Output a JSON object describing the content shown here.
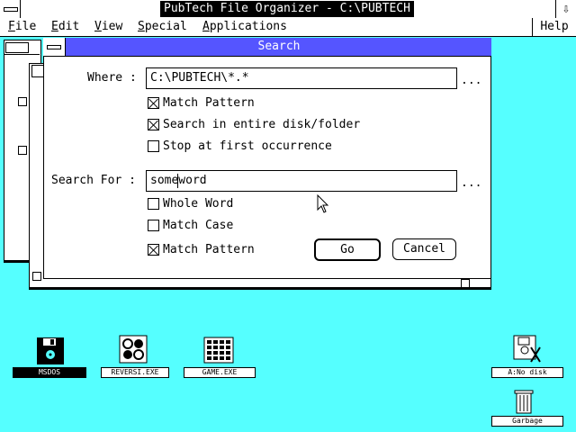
{
  "window": {
    "title": "PubTech File Organizer - C:\\PUBTECH",
    "down_arrow": "⇩"
  },
  "menubar": {
    "items": [
      {
        "label": "File"
      },
      {
        "label": "Edit"
      },
      {
        "label": "View"
      },
      {
        "label": "Special"
      },
      {
        "label": "Applications"
      }
    ],
    "help": "Help"
  },
  "dialog": {
    "title": "Search",
    "where_label": "Where :",
    "where_value": "C:\\PUBTECH\\*.*",
    "browse_dots": "...",
    "where_options": [
      {
        "label": "Match Pattern",
        "checked": true
      },
      {
        "label": "Search in entire disk/folder",
        "checked": true
      },
      {
        "label": "Stop at first occurrence",
        "checked": false
      }
    ],
    "search_label": "Search For :",
    "search_value": "someword",
    "search_options": [
      {
        "label": "Whole Word",
        "checked": false
      },
      {
        "label": "Match Case",
        "checked": false
      },
      {
        "label": "Match Pattern",
        "checked": true
      }
    ],
    "go_label": "Go",
    "cancel_label": "Cancel"
  },
  "desktop_icons": [
    {
      "label": "MSDOS",
      "selected": true
    },
    {
      "label": "REVERSI.EXE",
      "selected": false
    },
    {
      "label": "GAME.EXE",
      "selected": false
    },
    {
      "label": "A:No disk",
      "selected": false
    },
    {
      "label": "Garbage",
      "selected": false
    }
  ]
}
